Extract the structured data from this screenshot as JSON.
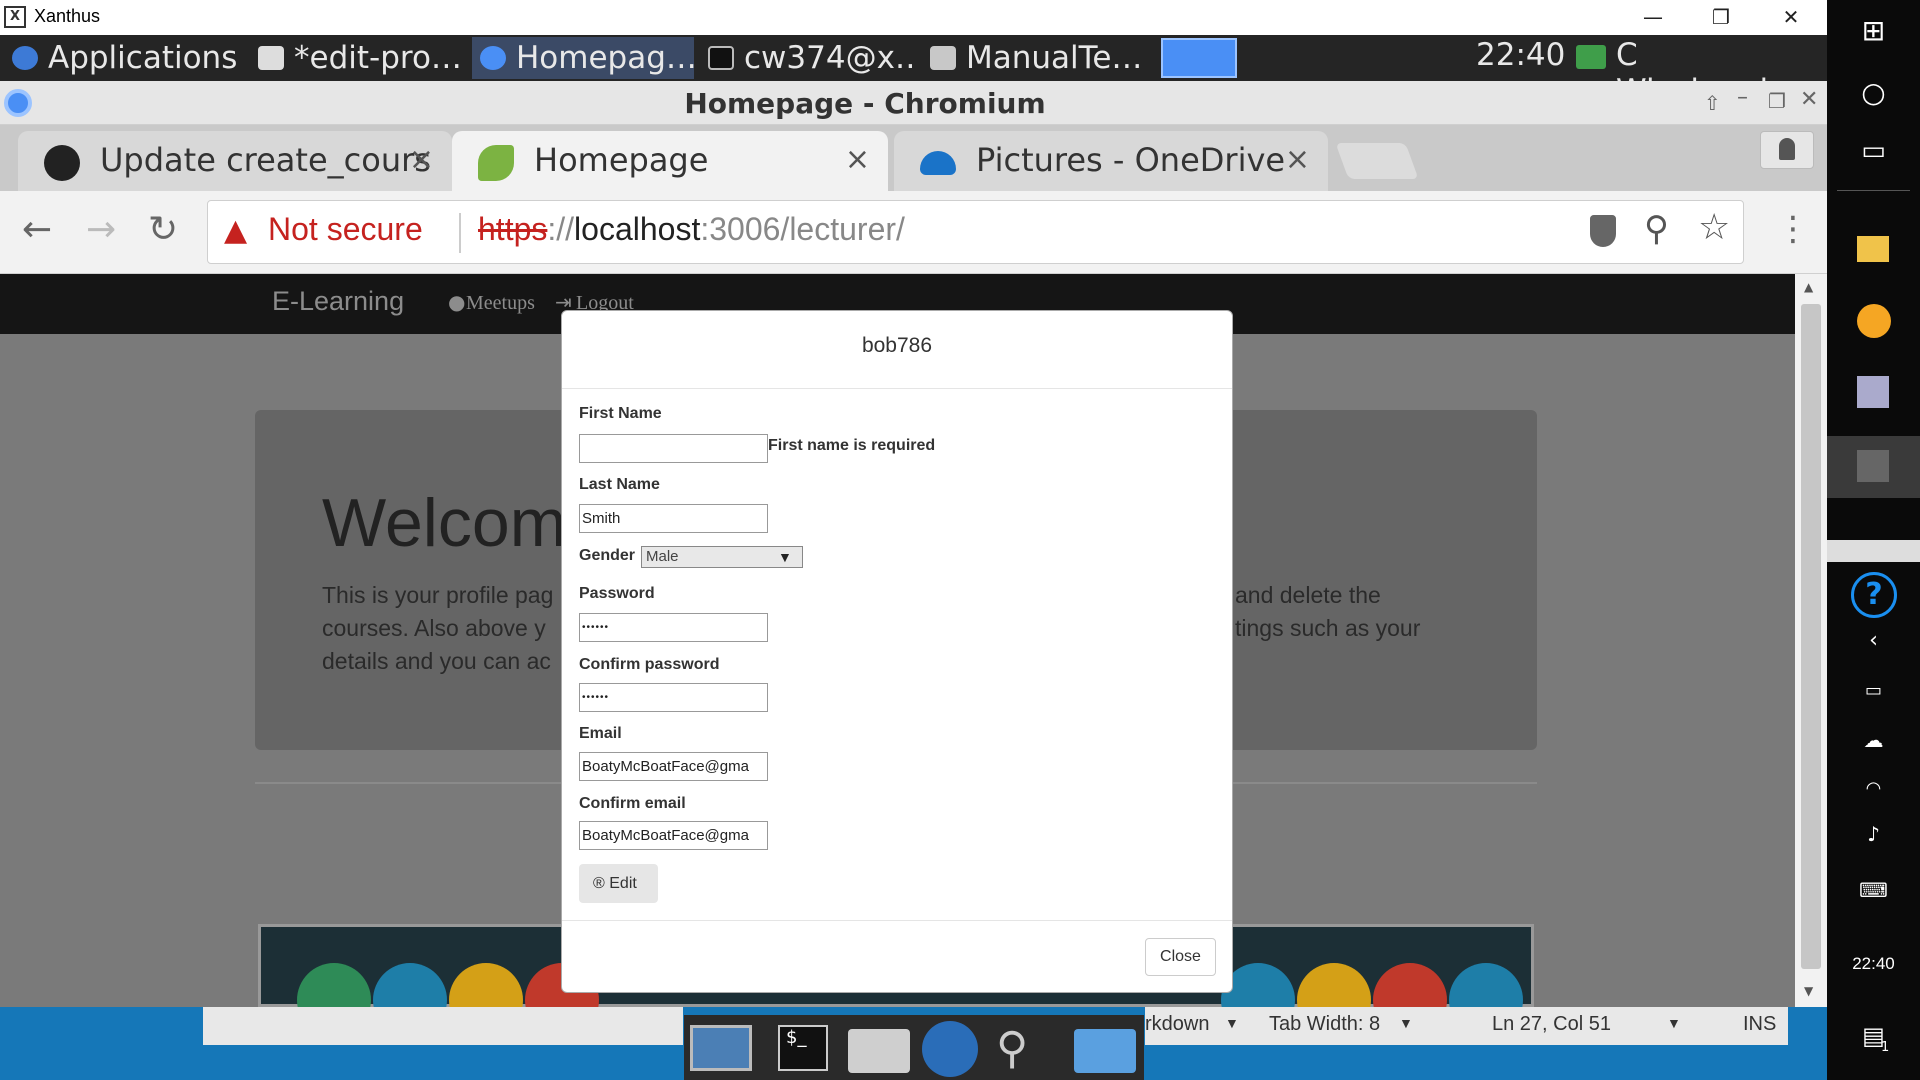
{
  "host_window": {
    "title": "Xanthus",
    "minimize": "—",
    "restore": "❐",
    "close": "✕"
  },
  "xfce_panel": {
    "applications": "Applications",
    "tasks": [
      {
        "label": "*edit-pro…"
      },
      {
        "label": "Homepag…"
      },
      {
        "label": "cw374@x…"
      },
      {
        "label": "ManualTe…"
      }
    ],
    "clock": "22:40",
    "user": "C Wisniewska"
  },
  "chromium": {
    "window_title": "Homepage - Chromium",
    "tabs": [
      {
        "label": "Update create_cours",
        "close": "×"
      },
      {
        "label": "Homepage",
        "close": "×"
      },
      {
        "label": "Pictures - OneDrive",
        "close": "×"
      }
    ],
    "omnibox": {
      "security": "Not secure",
      "scheme": "https",
      "sep": "://",
      "host": "localhost",
      "rest": ":3006/lecturer/"
    }
  },
  "page": {
    "brand": "E-Learning",
    "nav_meetups": "Meetups",
    "nav_logout": "Logout",
    "welcome": "Welcom",
    "line1_left": "This is your profile pag",
    "line2_left": "courses. Also above y",
    "line3_left": "details and you can ac",
    "line1_right": "and delete the",
    "line2_right": "tings such as your"
  },
  "modal": {
    "title": "bob786",
    "first_name_label": "First Name",
    "first_name_value": "",
    "first_name_error": "First name is required",
    "last_name_label": "Last Name",
    "last_name_value": "Smith",
    "gender_label": "Gender",
    "gender_value": "Male",
    "password_label": "Password",
    "password_value": "••••••",
    "confirm_password_label": "Confirm password",
    "confirm_password_value": "••••••",
    "email_label": "Email",
    "email_value": "BoatyMcBoatFace@gma",
    "confirm_email_label": "Confirm email",
    "confirm_email_value": "BoatyMcBoatFace@gma",
    "edit_icon": "®",
    "edit_label": "Edit",
    "close_label": "Close"
  },
  "editor_status": {
    "mode": "rkdown",
    "tab_width": "Tab Width: 8",
    "position": "Ln 27, Col 51",
    "ins": "INS"
  },
  "windows_bar": {
    "clock": "22:40",
    "notifications": "1"
  },
  "colors": {
    "accent": "#3b4a66",
    "taskbar_blue": "#1577b8",
    "not_secure": "#c5221f"
  }
}
